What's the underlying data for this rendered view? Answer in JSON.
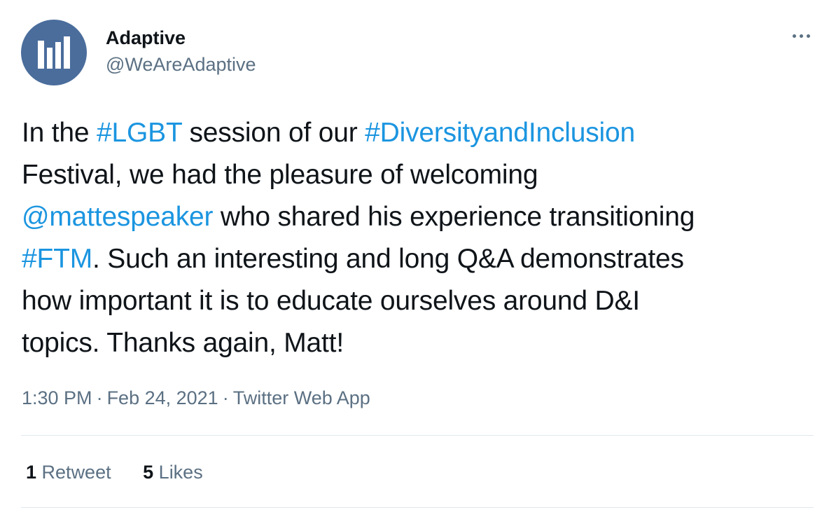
{
  "author": {
    "name": "Adaptive",
    "handle": "@WeAreAdaptive",
    "avatar_color": "#4a6d9c"
  },
  "menu": {
    "icon": "more-horizontal-icon"
  },
  "tweet": {
    "segments": {
      "s1": "In the ",
      "s2": "#LGBT",
      "s3": " session of our ",
      "s4": "#DiversityandInclusion",
      "s5": "Festival, we had the pleasure of welcoming",
      "s6": "@mattespeaker",
      "s7": " who shared his experience transitioning",
      "s8": "#FTM",
      "s9": ". Such an interesting and long Q&A demonstrates",
      "s10": "how important it is to educate ourselves around D&I",
      "s11": "topics. Thanks again, Matt!"
    },
    "link_color": "#1b95e0"
  },
  "meta": {
    "time": "1:30 PM",
    "separator": "·",
    "date": "Feb 24, 2021",
    "source": "Twitter Web App"
  },
  "stats": {
    "retweet_count": "1",
    "retweet_label": "Retweet",
    "likes_count": "5",
    "likes_label": "Likes"
  }
}
